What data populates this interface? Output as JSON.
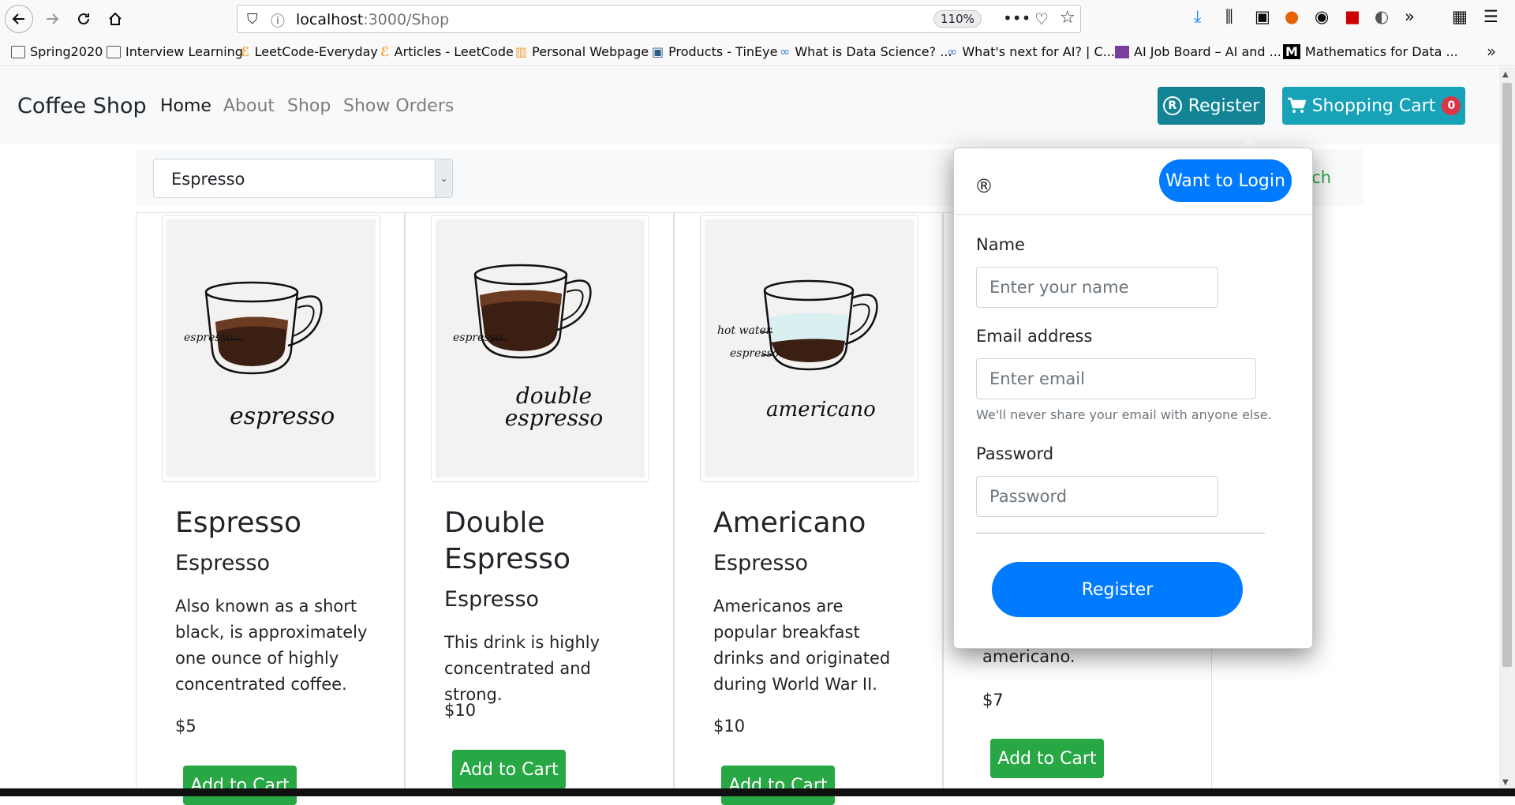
{
  "browser": {
    "url_host": "localhost",
    "url_path": ":3000/Shop",
    "zoom": "110%",
    "bookmarks": [
      "Spring2020",
      "Interview Learning",
      "LeetCode-Everyday",
      "Articles - LeetCode",
      "Personal Webpage",
      "Products - TinEye",
      "What is Data Science? ...",
      "What's next for AI? | C...",
      "AI Job Board – AI and ...",
      "Mathematics for Data ..."
    ]
  },
  "navbar": {
    "brand": "Coffee Shop",
    "links": [
      "Home",
      "About",
      "Shop",
      "Show Orders"
    ],
    "register_label": "Register",
    "cart_label": "Shopping Cart",
    "cart_count": "0"
  },
  "filter": {
    "selected": "Espresso",
    "search_fragment": "rch"
  },
  "products": [
    {
      "name": "Espresso",
      "category": "Espresso",
      "description": "Also known as a short black, is approximately one ounce of highly concentrated coffee.",
      "price": "$5",
      "button": "Add to Cart",
      "img_labels": [
        "espresso"
      ],
      "img_caption": "espresso"
    },
    {
      "name": "Double Espresso",
      "category": "Espresso",
      "description": "This drink is highly concentrated and strong.",
      "price": "$10",
      "button": "Add to Cart",
      "img_labels": [
        "espresso"
      ],
      "img_caption": "double espresso"
    },
    {
      "name": "Americano",
      "category": "Espresso",
      "description": "Americanos are popular breakfast drinks and originated during World War II.",
      "price": "$10",
      "button": "Add to Cart",
      "img_labels": [
        "hot water",
        "espresso"
      ],
      "img_caption": "americano"
    },
    {
      "description_tail": "americano.",
      "price": "$7",
      "button": "Add to Cart"
    }
  ],
  "register_popover": {
    "icon": "®",
    "login_button": "Want to Login",
    "name_label": "Name",
    "name_placeholder": "Enter your name",
    "email_label": "Email address",
    "email_placeholder": "Enter email",
    "email_help": "We'll never share your email with anyone else.",
    "password_label": "Password",
    "password_placeholder": "Password",
    "submit_label": "Register"
  },
  "colors": {
    "info": "#17a2b8",
    "primary": "#007bff",
    "success": "#28a745",
    "danger": "#dc3545"
  }
}
